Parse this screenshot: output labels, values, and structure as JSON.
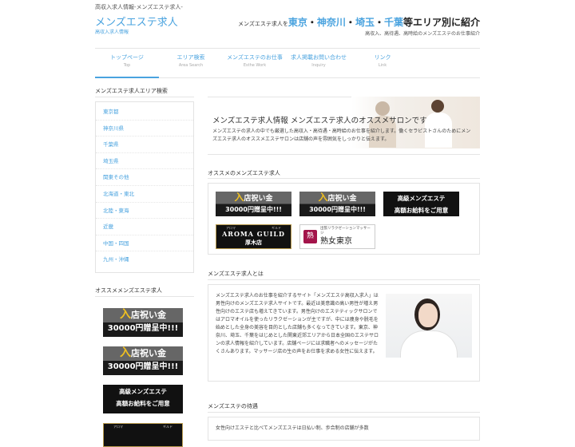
{
  "header": {
    "topline": "高収入求人情報-メンズエステ求人-",
    "logo": "メンズエステ求人",
    "logo_sub": "高収入求人情報",
    "tagline_pre": "メンズエステ求人を",
    "tagline_a1": "東京",
    "tagline_sep1": "・",
    "tagline_a2": "神奈川",
    "tagline_sep2": "・",
    "tagline_a3": "埼玉",
    "tagline_sep3": "・",
    "tagline_a4": "千葉",
    "tagline_post": "等エリア別に紹介",
    "tagline_sub": "高収入、高待遇、高時給のメンズエステのお仕事紹介"
  },
  "nav": [
    {
      "label": "トップページ",
      "sub": "Top"
    },
    {
      "label": "エリア検索",
      "sub": "Area Search"
    },
    {
      "label": "メンズエステのお仕事",
      "sub": "Esthe Work"
    },
    {
      "label": "求人掲載お問い合わせ",
      "sub": "Inquiry"
    },
    {
      "label": "リンク",
      "sub": "Link"
    }
  ],
  "sidebar": {
    "area_title": "メンズエステ求人エリア検索",
    "areas": [
      "東京都",
      "神奈川県",
      "千葉県",
      "埼玉県",
      "関東その他",
      "北海道・東北",
      "北陸・東海",
      "近畿",
      "中国・四国",
      "九州・沖縄"
    ],
    "rec_title": "オススメメンズエステ求人"
  },
  "banners": {
    "iwai_kanji": "入",
    "iwai_line1": "店祝い金",
    "iwai_line2": "30000円贈呈中!!!",
    "black_line1": "高級メンズエステ",
    "black_line2": "高額お給料をご用意",
    "aroma_ruby_left": "アロマ",
    "aroma_ruby_right": "ギルド",
    "aroma_line1": "AROMA GUILD",
    "aroma_line2": "厚木店",
    "jukujo_mark": "熟",
    "jukujo_small": "出張リラクゼーションマッサージ",
    "jukujo_big": "熟女東京"
  },
  "main": {
    "hero_title": "メンズエステ求人情報 メンズエステ求人のオススメサロンです",
    "hero_text": "メンズエステの求人の中でも厳選した高収入・高待遇・高時給のお仕事を紹介します。働くセラピストさんのためにメンズエステ求人のオススメエステサロンは店舗の声を雰囲気をしっかりと伝えます。",
    "rec_title": "オススメのメンズエステ求人",
    "about_title": "メンズエステ求人とは",
    "about_text": "メンズエステ求人のお仕事を紹介するサイト「メンズエステ高収入求人」は男性向けのメンズエステ求人サイトです。最近は美意識の高い男性が増え男性向けのエステ店も増えてきています。男性向けのエステティックサロンではアロマオイルを使ったリラクゼーションが主ですが、中には痩身や脱毛を始めとした全身の美容を目的とした店舗も多くなってきています。東京、神奈川、埼玉、千葉をはじめとした関東近郊エリアから日本全国のエステサロンの求人情報を紹介しています。店舗ページには求職者へのメッセージがたくさんあります。マッサージ店の生の声をお仕事を求める女性に伝えます。",
    "treat_title": "メンズエステの待遇",
    "treat_text": "女性向けエステと比べてメンズエステは日払い制、歩合制の店舗が多数"
  },
  "colors": {
    "accent": "#4aa3df",
    "gold": "#f0c020",
    "jukujo": "#a3144a"
  }
}
